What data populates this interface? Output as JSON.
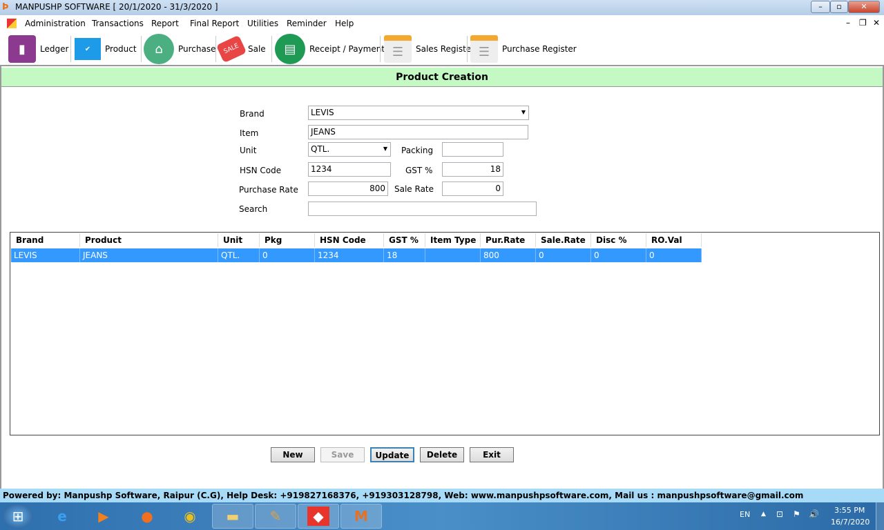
{
  "window": {
    "title": "MANPUSHP SOFTWARE [ 20/1/2020 - 31/3/2020 ]"
  },
  "menu": [
    "Administration",
    "Transactions",
    "Report",
    "Final Report",
    "Utilities",
    "Reminder",
    "Help"
  ],
  "toolbar": [
    {
      "label": "Ledger",
      "icon": "ledger-book-icon",
      "color": "#8b3a8f"
    },
    {
      "label": "Product",
      "icon": "products-check-icon",
      "color": "#1e9be8"
    },
    {
      "label": "Purchase",
      "icon": "basket-icon",
      "color": "#4caf82"
    },
    {
      "label": "Sale",
      "icon": "sale-tag-icon",
      "color": "#e84545"
    },
    {
      "label": "Receipt / Payment",
      "icon": "wallet-icon",
      "color": "#1f9a55"
    },
    {
      "label": "Sales Register",
      "icon": "register-icon",
      "color": "#e8e8e8"
    },
    {
      "label": "Purchase Register",
      "icon": "register-icon",
      "color": "#e8e8e8"
    }
  ],
  "header": {
    "title": "Product Creation"
  },
  "form": {
    "brand_label": "Brand",
    "brand": "LEVIS",
    "item_label": "Item",
    "item": "JEANS",
    "unit_label": "Unit",
    "unit": "QTL.",
    "packing_label": "Packing",
    "packing": "",
    "hsn_label": "HSN Code",
    "hsn": "1234",
    "gst_label": "GST %",
    "gst": "18",
    "purchase_rate_label": "Purchase Rate",
    "purchase_rate": "800",
    "sale_rate_label": "Sale Rate",
    "sale_rate": "0",
    "search_label": "Search",
    "search": ""
  },
  "grid": {
    "columns": [
      "Brand",
      "Product",
      "Unit",
      "Pkg",
      "HSN Code",
      "GST %",
      "Item Type",
      "Pur.Rate",
      "Sale.Rate",
      "Disc %",
      "RO.Val"
    ],
    "rows": [
      [
        "LEVIS",
        "JEANS",
        "QTL.",
        "0",
        "1234",
        "18",
        "",
        "800",
        "0",
        "0",
        "0"
      ]
    ]
  },
  "buttons": {
    "new": "New",
    "save": "Save",
    "update": "Update",
    "delete": "Delete",
    "exit": "Exit"
  },
  "footer": "Powered by: Manpushp Software, Raipur (C.G), Help Desk: +919827168376, +919303128798, Web: www.manpushpsoftware.com,  Mail us :  manpushpsoftware@gmail.com",
  "taskbar": {
    "lang": "EN",
    "time": "3:55 PM",
    "date": "16/7/2020"
  }
}
